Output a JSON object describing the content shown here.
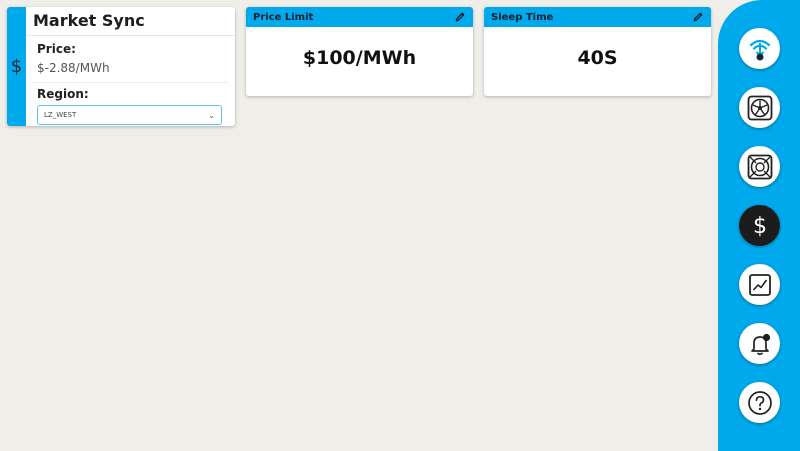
{
  "market": {
    "title": "Market Sync",
    "icon": "dollar-icon",
    "price_label": "Price:",
    "price_value": "$-2.88/MWh",
    "region_label": "Region:",
    "region_value": "LZ_WEST"
  },
  "cards": {
    "price_limit": {
      "title": "Price Limit",
      "value": "$100/MWh"
    },
    "sleep_time": {
      "title": "Sleep Time",
      "value": "40S"
    }
  },
  "sidebar": {
    "items": [
      {
        "icon": "logo-icon"
      },
      {
        "icon": "fan-icon"
      },
      {
        "icon": "miner-icon"
      },
      {
        "icon": "dollar-icon",
        "active": true
      },
      {
        "icon": "chart-icon"
      },
      {
        "icon": "bell-notification-icon"
      },
      {
        "icon": "help-icon"
      }
    ]
  },
  "colors": {
    "accent": "#00a8ec",
    "background": "#efeee9",
    "active_button": "#1c1c1c"
  }
}
